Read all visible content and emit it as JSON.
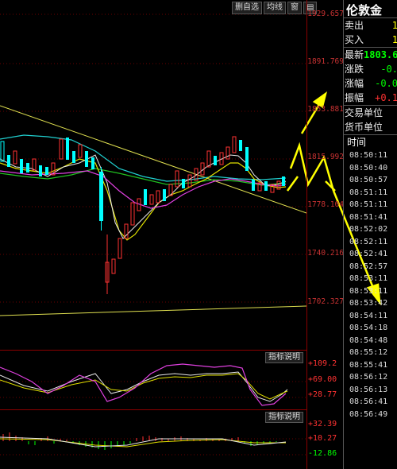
{
  "toolbar": {
    "btn1": "删自选",
    "btn2": "均线",
    "btn3": "窗",
    "icon": "dropdown-icon"
  },
  "price_axis": [
    "1929.657",
    "1891.769",
    "1853.881",
    "1815.992",
    "1778.104",
    "1740.216",
    "1702.327"
  ],
  "indicator1": {
    "button": "指标说明",
    "ticks": [
      "+109.2",
      "+69.00",
      "+28.77"
    ]
  },
  "indicator2": {
    "button": "指标说明",
    "ticks": [
      "+32.39",
      "+10.27",
      "-12.86"
    ]
  },
  "quote": {
    "title": "伦敦金",
    "rows": [
      {
        "label": "卖出",
        "value": "1",
        "color": "#ffff00"
      },
      {
        "label": "买入",
        "value": "1",
        "color": "#ffff00"
      },
      {
        "label": "最新",
        "value": "1803.6",
        "color": "#00ff00"
      },
      {
        "label": "涨跌",
        "value": "-0.",
        "color": "#00ff00"
      },
      {
        "label": "涨幅",
        "value": "-0.0",
        "color": "#00ff00"
      },
      {
        "label": "振幅",
        "value": "+0.1",
        "color": "#ff3232"
      }
    ],
    "trade_unit_label": "交易单位",
    "currency_unit_label": "货币单位",
    "time_header": "时间",
    "times": [
      "08:50:11",
      "08:50:40",
      "08:50:57",
      "08:51:11",
      "08:51:11",
      "08:51:41",
      "08:52:02",
      "08:52:11",
      "08:52:41",
      "08:52:57",
      "08:53:11",
      "08:53:11",
      "08:53:42",
      "08:54:11",
      "08:54:18",
      "08:54:48",
      "08:55:12",
      "08:55:41",
      "08:56:12",
      "08:56:13",
      "08:56:41",
      "08:56:49"
    ]
  },
  "colors": {
    "up": "#ff3232",
    "down": "#00ffff",
    "axis": "#c83232",
    "grid": "#8b0000"
  }
}
